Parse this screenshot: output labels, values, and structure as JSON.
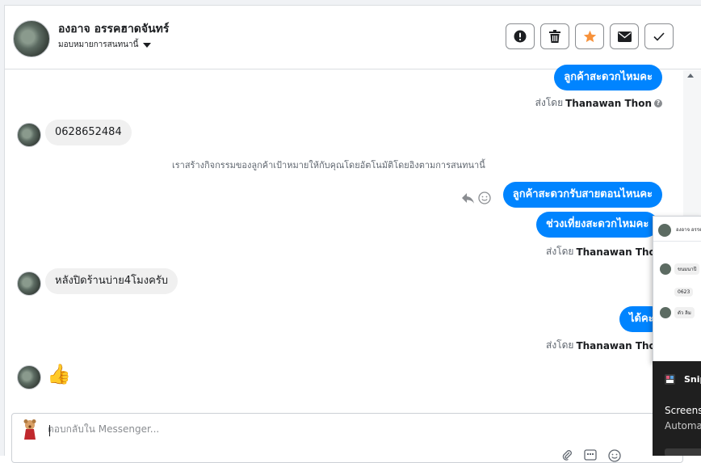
{
  "header": {
    "contact_name": "องอาจ อรรคฮาดจันทร์",
    "assign_label": "มอบหมายการสนทนานี้",
    "buttons": [
      {
        "name": "mark-spam-button",
        "icon": "exclamation-circle-icon"
      },
      {
        "name": "delete-button",
        "icon": "trash-icon"
      },
      {
        "name": "star-button",
        "icon": "star-icon",
        "color": "#f7923b"
      },
      {
        "name": "mark-unread-button",
        "icon": "envelope-icon"
      },
      {
        "name": "mark-done-button",
        "icon": "check-icon"
      }
    ]
  },
  "conversation": {
    "out_msg_1": "ลูกค้าสะดวกไหมคะ",
    "sent_by_label": "ส่งโดย",
    "sender_name": "Thanawan Thon",
    "in_msg_1": "0628652484",
    "system_msg": "เราสร้างกิจกรรมของลูกค้าเป้าหมายให้กับคุณโดยอัตโนมัติโดยอิงตามการสนทนานี้",
    "out_msg_2": "ลูกค้าสะดวกรับสายตอนไหนคะ",
    "out_msg_3": "ช่วงเที่ยงสะดวกไหมคะ",
    "in_msg_2": "หลังปิดร้านบ่าย4โมงครับ",
    "out_msg_4": "ได้คะ",
    "in_msg_3": "👍"
  },
  "composer": {
    "placeholder": "ตอบกลับใน Messenger..."
  },
  "overlay": {
    "snip_title": "Snip",
    "snip_line1": "Screens",
    "snip_line2": "Automa",
    "thumb_name": "องอาจ อรรค",
    "thumb_msg_a": "ขนมนาปี",
    "thumb_msg_b": "0623",
    "thumb_msg_c": "ตัว ลิม"
  },
  "colors": {
    "accent": "#0084ff",
    "star": "#f7923b",
    "incoming_bubble": "#f0f0f0"
  }
}
